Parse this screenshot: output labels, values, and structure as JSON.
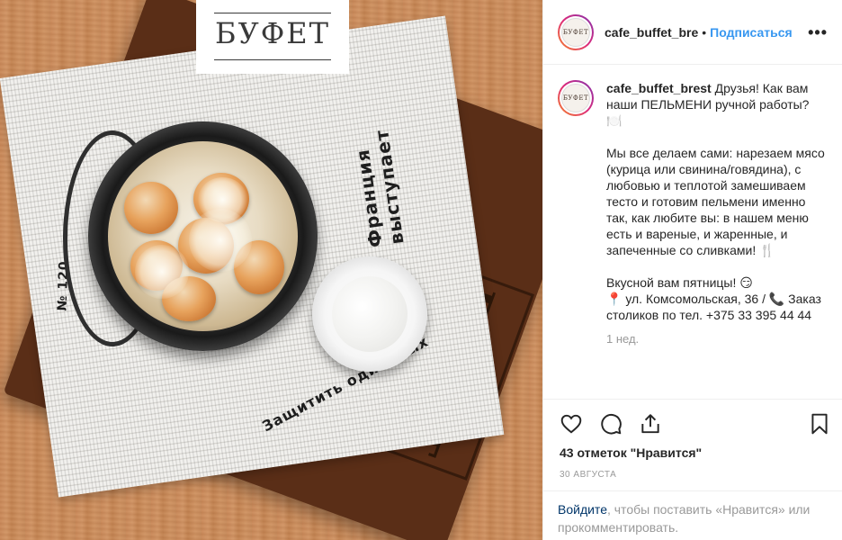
{
  "photo": {
    "logo_text": "БУФЕТ",
    "board_stamp": "БУФЕТ",
    "newspaper_headlines": [
      "Франция выступает",
      "Защитить одинокых",
      "№ 120"
    ]
  },
  "post": {
    "header": {
      "username": "cafe_buffet_bre",
      "separator": "•",
      "follow_label": "Подписаться",
      "more_label": "•••"
    },
    "avatar_text": "БУФЕТ",
    "caption": {
      "username": "cafe_buffet_brest",
      "line1": " Друзья! Как вам наши ПЕЛЬМЕНИ ручной работы? 🍽️",
      "para2": "Мы все делаем сами: нарезаем мясо (курица или свинина/говядина), с любовью и теплотой замешиваем тесто и готовим пельмени именно так, как любите вы: в нашем меню есть и вареные, и жаренные, и запеченные со сливками! 🍴",
      "para3a": "Вкусной вам пятницы! 😏",
      "para3b": "📍 ул. Комсомольская, 36 / 📞 Заказ столиков по тел. +375 33 395 44 44",
      "time": "1 нед."
    },
    "actions": {
      "like_icon": "heart-icon",
      "comment_icon": "comment-icon",
      "share_icon": "share-icon",
      "save_icon": "bookmark-icon"
    },
    "likes": "43 отметок \"Нравится\"",
    "date": "30 АВГУСТА",
    "login": {
      "link": "Войдите",
      "text": ", чтобы поставить «Нравится» или прокомментировать."
    }
  },
  "colors": {
    "accent": "#3897f0",
    "text": "#262626",
    "muted": "#999999",
    "border": "#efefef"
  }
}
